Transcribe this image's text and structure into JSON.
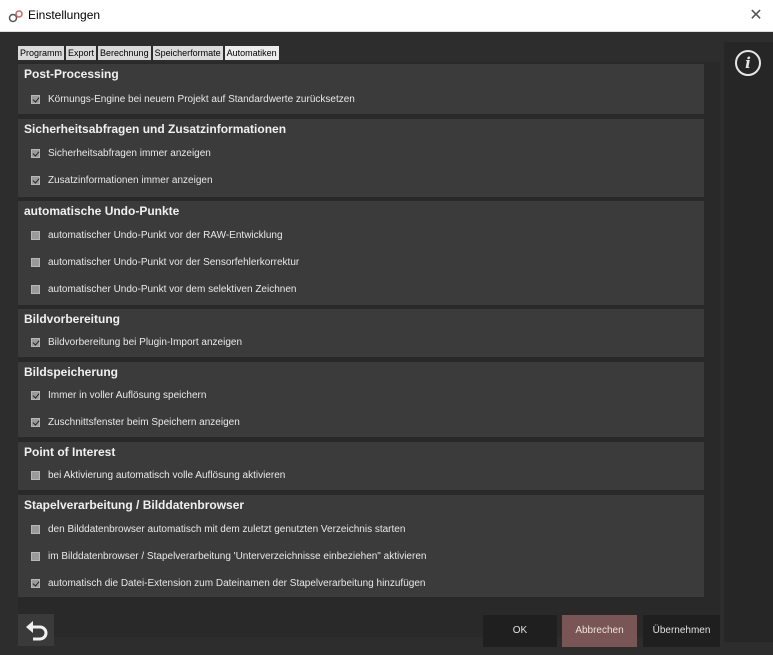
{
  "window": {
    "title": "Einstellungen",
    "close_symbol": "✕"
  },
  "tabs": [
    {
      "label": "Programm"
    },
    {
      "label": "Export"
    },
    {
      "label": "Berechnung"
    },
    {
      "label": "Speicherformate"
    },
    {
      "label": "Automatiken",
      "active": true
    }
  ],
  "sections": [
    {
      "title": "Post-Processing",
      "options": [
        {
          "label": "Körnungs-Engine bei neuem Projekt auf Standardwerte zurücksetzen",
          "checked": true
        }
      ]
    },
    {
      "title": "Sicherheitsabfragen und Zusatzinformationen",
      "options": [
        {
          "label": "Sicherheitsabfragen immer anzeigen",
          "checked": true
        },
        {
          "label": "Zusatzinformationen immer anzeigen",
          "checked": true
        }
      ]
    },
    {
      "title": "automatische Undo-Punkte",
      "options": [
        {
          "label": "automatischer Undo-Punkt vor der RAW-Entwicklung",
          "checked": false
        },
        {
          "label": "automatischer Undo-Punkt vor der Sensorfehlerkorrektur",
          "checked": false
        },
        {
          "label": "automatischer Undo-Punkt vor dem selektiven Zeichnen",
          "checked": false
        }
      ]
    },
    {
      "title": "Bildvorbereitung",
      "options": [
        {
          "label": "Bildvorbereitung bei Plugin-Import anzeigen",
          "checked": true
        }
      ]
    },
    {
      "title": "Bildspeicherung",
      "options": [
        {
          "label": "Immer in voller Auflösung speichern",
          "checked": true
        },
        {
          "label": "Zuschnittsfenster beim Speichern anzeigen",
          "checked": true
        }
      ]
    },
    {
      "title": "Point of Interest",
      "options": [
        {
          "label": "bei Aktivierung automatisch volle Auflösung aktivieren",
          "checked": false
        }
      ]
    },
    {
      "title": "Stapelverarbeitung / Bilddatenbrowser",
      "options": [
        {
          "label": "den Bilddatenbrowser automatisch mit dem zuletzt genutzten Verzeichnis starten",
          "checked": false
        },
        {
          "label": "im Bilddatenbrowser / Stapelverarbeitung 'Unterverzeichnisse einbeziehen\" aktivieren",
          "checked": false
        },
        {
          "label": "automatisch die Datei-Extension zum Dateinamen der Stapelverarbeitung hinzufügen",
          "checked": true
        }
      ]
    }
  ],
  "sidebar": {
    "info_symbol": "i"
  },
  "footer": {
    "ok_label": "OK",
    "cancel_label": "Abbrechen",
    "apply_label": "Übernehmen"
  },
  "colors": {
    "background": "#2d2d2d",
    "section": "#3b3b3b",
    "cancel_button": "#7a5555"
  }
}
